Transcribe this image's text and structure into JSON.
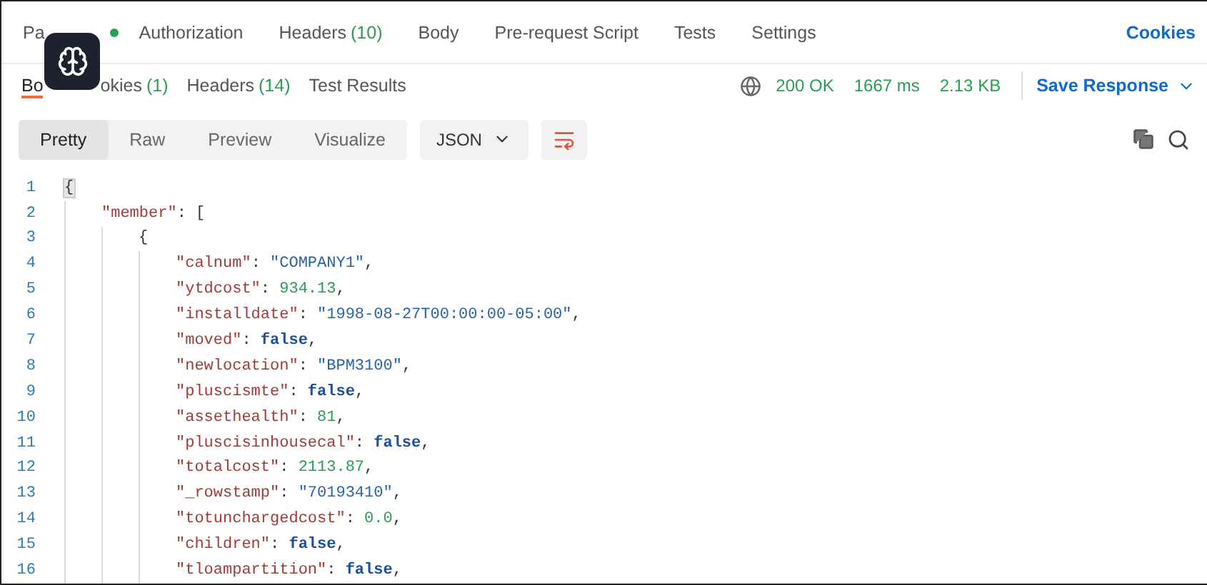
{
  "request_tabs": [
    {
      "label": "Pa",
      "dot": true,
      "selected": false
    },
    {
      "label": "Authorization",
      "dot": false,
      "selected": false
    },
    {
      "label": "Headers",
      "count": "(10)",
      "dot": false,
      "selected": false
    },
    {
      "label": "Body",
      "dot": false,
      "selected": false
    },
    {
      "label": "Pre-request Script",
      "dot": false,
      "selected": false
    },
    {
      "label": "Tests",
      "dot": false,
      "selected": false
    },
    {
      "label": "Settings",
      "dot": false,
      "selected": false
    }
  ],
  "cookies_link": "Cookies",
  "response_tabs": [
    {
      "label": "Bo",
      "selected": true
    },
    {
      "label": "okies",
      "count": "(1)",
      "selected": false
    },
    {
      "label": "Headers",
      "count": "(14)",
      "selected": false
    },
    {
      "label": "Test Results",
      "selected": false
    }
  ],
  "status": {
    "code": "200 OK",
    "time": "1667 ms",
    "size": "2.13 KB"
  },
  "save_response": "Save Response",
  "view_modes": [
    {
      "label": "Pretty",
      "selected": true
    },
    {
      "label": "Raw",
      "selected": false
    },
    {
      "label": "Preview",
      "selected": false
    },
    {
      "label": "Visualize",
      "selected": false
    }
  ],
  "format": "JSON",
  "code_lines": [
    {
      "number": "1",
      "tokens": [
        {
          "kind": "bracket",
          "text": "{"
        }
      ],
      "children": [
        {
          "number": "2",
          "tokens": [
            {
              "kind": "key",
              "text": "\"member\""
            },
            {
              "kind": "punct",
              "text": ": ["
            }
          ],
          "children": [
            {
              "number": "3",
              "tokens": [
                {
                  "kind": "punct",
                  "text": "{"
                }
              ],
              "children": [
                {
                  "number": "4",
                  "tokens": [
                    {
                      "kind": "key",
                      "text": "\"calnum\""
                    },
                    {
                      "kind": "punct",
                      "text": ": "
                    },
                    {
                      "kind": "string",
                      "text": "\"COMPANY1\""
                    },
                    {
                      "kind": "punct",
                      "text": ","
                    }
                  ]
                },
                {
                  "number": "5",
                  "tokens": [
                    {
                      "kind": "key",
                      "text": "\"ytdcost\""
                    },
                    {
                      "kind": "punct",
                      "text": ": "
                    },
                    {
                      "kind": "number",
                      "text": "934.13"
                    },
                    {
                      "kind": "punct",
                      "text": ","
                    }
                  ]
                },
                {
                  "number": "6",
                  "tokens": [
                    {
                      "kind": "key",
                      "text": "\"installdate\""
                    },
                    {
                      "kind": "punct",
                      "text": ": "
                    },
                    {
                      "kind": "string",
                      "text": "\"1998-08-27T00:00:00-05:00\""
                    },
                    {
                      "kind": "punct",
                      "text": ","
                    }
                  ]
                },
                {
                  "number": "7",
                  "tokens": [
                    {
                      "kind": "key",
                      "text": "\"moved\""
                    },
                    {
                      "kind": "punct",
                      "text": ": "
                    },
                    {
                      "kind": "boolean",
                      "text": "false"
                    },
                    {
                      "kind": "punct",
                      "text": ","
                    }
                  ]
                },
                {
                  "number": "8",
                  "tokens": [
                    {
                      "kind": "key",
                      "text": "\"newlocation\""
                    },
                    {
                      "kind": "punct",
                      "text": ": "
                    },
                    {
                      "kind": "string",
                      "text": "\"BPM3100\""
                    },
                    {
                      "kind": "punct",
                      "text": ","
                    }
                  ]
                },
                {
                  "number": "9",
                  "tokens": [
                    {
                      "kind": "key",
                      "text": "\"pluscismte\""
                    },
                    {
                      "kind": "punct",
                      "text": ": "
                    },
                    {
                      "kind": "boolean",
                      "text": "false"
                    },
                    {
                      "kind": "punct",
                      "text": ","
                    }
                  ]
                },
                {
                  "number": "10",
                  "tokens": [
                    {
                      "kind": "key",
                      "text": "\"assethealth\""
                    },
                    {
                      "kind": "punct",
                      "text": ": "
                    },
                    {
                      "kind": "number",
                      "text": "81"
                    },
                    {
                      "kind": "punct",
                      "text": ","
                    }
                  ]
                },
                {
                  "number": "11",
                  "tokens": [
                    {
                      "kind": "key",
                      "text": "\"pluscisinhousecal\""
                    },
                    {
                      "kind": "punct",
                      "text": ": "
                    },
                    {
                      "kind": "boolean",
                      "text": "false"
                    },
                    {
                      "kind": "punct",
                      "text": ","
                    }
                  ]
                },
                {
                  "number": "12",
                  "tokens": [
                    {
                      "kind": "key",
                      "text": "\"totalcost\""
                    },
                    {
                      "kind": "punct",
                      "text": ": "
                    },
                    {
                      "kind": "number",
                      "text": "2113.87"
                    },
                    {
                      "kind": "punct",
                      "text": ","
                    }
                  ]
                },
                {
                  "number": "13",
                  "tokens": [
                    {
                      "kind": "key",
                      "text": "\"_rowstamp\""
                    },
                    {
                      "kind": "punct",
                      "text": ": "
                    },
                    {
                      "kind": "string",
                      "text": "\"70193410\""
                    },
                    {
                      "kind": "punct",
                      "text": ","
                    }
                  ]
                },
                {
                  "number": "14",
                  "tokens": [
                    {
                      "kind": "key",
                      "text": "\"totunchargedcost\""
                    },
                    {
                      "kind": "punct",
                      "text": ": "
                    },
                    {
                      "kind": "number",
                      "text": "0.0"
                    },
                    {
                      "kind": "punct",
                      "text": ","
                    }
                  ]
                },
                {
                  "number": "15",
                  "tokens": [
                    {
                      "kind": "key",
                      "text": "\"children\""
                    },
                    {
                      "kind": "punct",
                      "text": ": "
                    },
                    {
                      "kind": "boolean",
                      "text": "false"
                    },
                    {
                      "kind": "punct",
                      "text": ","
                    }
                  ]
                },
                {
                  "number": "16",
                  "tokens": [
                    {
                      "kind": "key",
                      "text": "\"tloampartition\""
                    },
                    {
                      "kind": "punct",
                      "text": ": "
                    },
                    {
                      "kind": "boolean",
                      "text": "false"
                    },
                    {
                      "kind": "punct",
                      "text": ","
                    }
                  ]
                }
              ]
            }
          ]
        }
      ]
    }
  ]
}
